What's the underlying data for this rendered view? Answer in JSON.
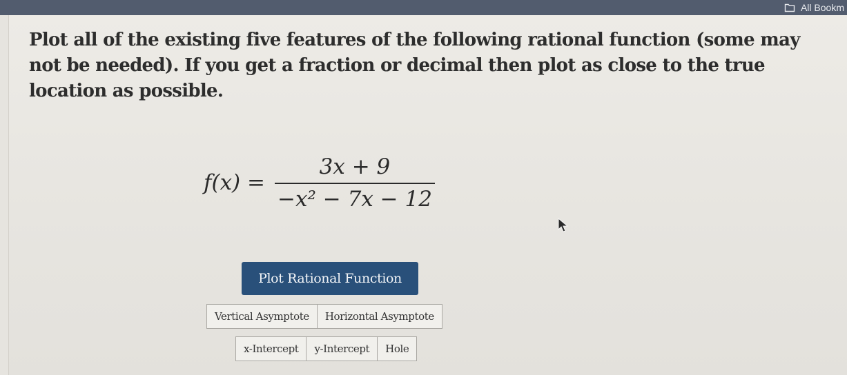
{
  "bookmarks_bar": {
    "all_bookmarks_label": "All Bookm",
    "icon": "folder-icon"
  },
  "question": {
    "instructions": "Plot all of the existing five features of the following rational function (some may not be needed). If you get a fraction or decimal then plot as close to the true location as possible.",
    "function_lhs": "f(x) =",
    "numerator": "3x + 9",
    "denominator": "−x² − 7x − 12"
  },
  "plot_button_label": "Plot Rational Function",
  "feature_rows": [
    [
      "Vertical Asymptote",
      "Horizontal Asymptote"
    ],
    [
      "x-Intercept",
      "y-Intercept",
      "Hole"
    ]
  ],
  "colors": {
    "bookmark_bar": "#525c6e",
    "primary_button": "#29507a",
    "page_background": "#e9e7e2"
  }
}
